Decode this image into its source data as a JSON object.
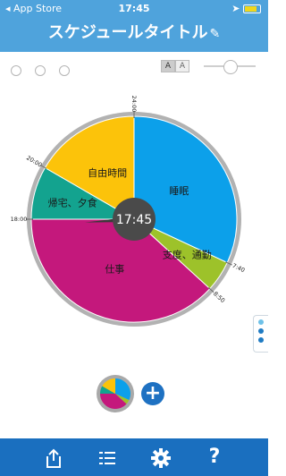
{
  "status": {
    "carrier": "◂ App Store",
    "time": "17:45"
  },
  "header": {
    "title": "スケジュールタイトル",
    "edit_icon": "✎"
  },
  "toolbar": {
    "font_small": "A",
    "font_large": "A"
  },
  "clock": {
    "center_time": "17:45"
  },
  "chart_data": {
    "type": "pie",
    "unit": "hours",
    "start": "00:00 at top, clockwise",
    "slices": [
      {
        "label": "睡眠",
        "start": "0:00",
        "end": "7:40",
        "color": "#0ca0ea"
      },
      {
        "label": "支度、通勤",
        "start": "7:40",
        "end": "8:50",
        "color": "#9dc22a"
      },
      {
        "label": "仕事",
        "start": "8:50",
        "end": "18:00",
        "color": "#c4187c"
      },
      {
        "label": "帰宅、夕食",
        "start": "18:00",
        "end": "20:00",
        "color": "#13a38f"
      },
      {
        "label": "自由時間",
        "start": "20:00",
        "end": "24:00",
        "color": "#fcc30a"
      }
    ],
    "tick_labels": [
      "24:00",
      "7:40",
      "8:50",
      "18:00",
      "20:00"
    ]
  },
  "side_dots": [
    "#6ec1e8",
    "#1f7bc3",
    "#1f7bc3"
  ],
  "tabs": {
    "share_icon": "share-icon",
    "list_icon": "list-icon",
    "settings_icon": "gear-icon",
    "help_label": "?"
  }
}
